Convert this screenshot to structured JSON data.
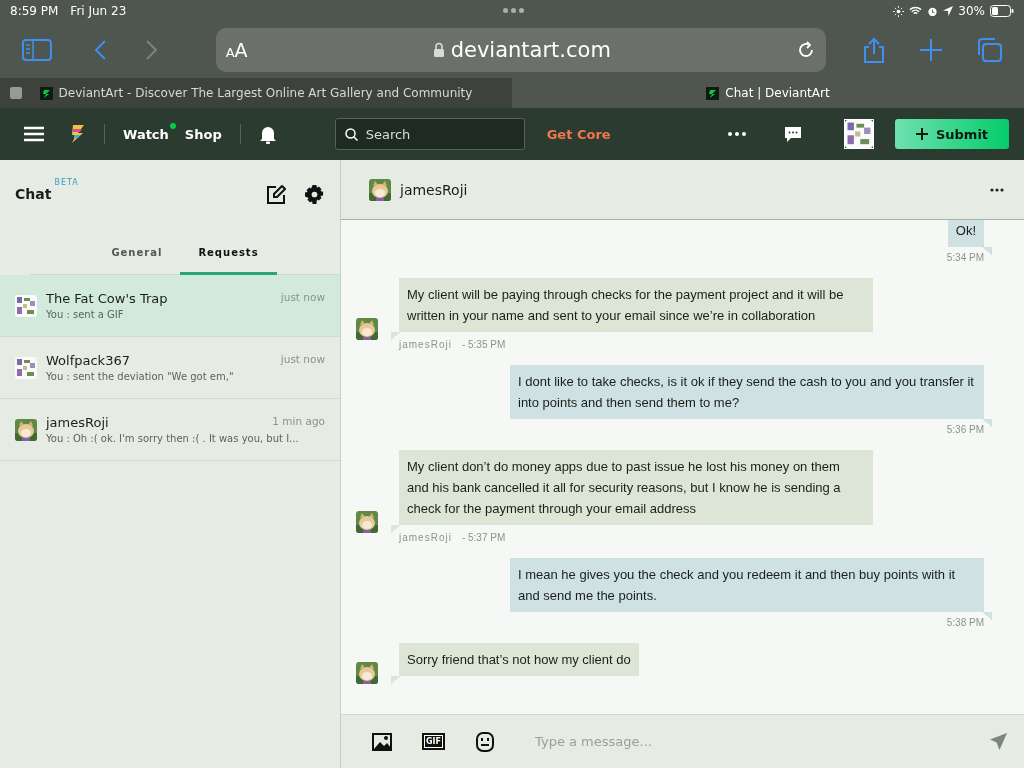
{
  "status_bar": {
    "time": "8:59 PM",
    "date": "Fri Jun 23",
    "battery": "30%"
  },
  "browser": {
    "text_size": "AA",
    "url": "deviantart.com",
    "tabs": [
      {
        "title": "DeviantArt - Discover The Largest Online Art Gallery and Community",
        "selected": false
      },
      {
        "title": "Chat | DeviantArt",
        "selected": true
      }
    ]
  },
  "nav": {
    "links": [
      {
        "label": "Watch",
        "has_update": true
      },
      {
        "label": "Shop",
        "has_update": false
      }
    ],
    "search": {
      "placeholder": "Search"
    },
    "get_core": "Get Core",
    "submit": "Submit"
  },
  "chat_list": {
    "title": "Chat",
    "badge": "BETA",
    "tabs": [
      {
        "label": "General",
        "selected": false
      },
      {
        "label": "Requests",
        "selected": true
      }
    ],
    "conversations": [
      {
        "name": "The Fat Cow's Trap",
        "preview": "You : sent a GIF",
        "time": "just now",
        "selected": true
      },
      {
        "name": "Wolfpack367",
        "preview": "You : sent the deviation \"We got em,\"",
        "time": "just now",
        "selected": false
      },
      {
        "name": "jamesRoji",
        "preview": "You : Oh :( ok. I'm sorry then :( . It was you, but I...",
        "time": "1 min ago",
        "selected": false
      }
    ]
  },
  "conversation": {
    "name": "jamesRoji",
    "messages": [
      {
        "kind": "sent",
        "text": "Ok!",
        "time": "5:34 PM"
      },
      {
        "kind": "received",
        "text": "My client will be paying through checks for the payment project and it will be written in your name and sent to your email since we’re in collaboration",
        "sender": "jamesRoji",
        "time": "- 5:35 PM"
      },
      {
        "kind": "sent",
        "text": "I dont like to take checks, is it ok if they send the cash to you and you transfer it into points and then send them to me?",
        "time": "5:36 PM"
      },
      {
        "kind": "received",
        "text": "My client don’t do money apps due to past issue he lost his money on them and his bank cancelled it all for security reasons, but I know he is sending a check for the payment through your email address",
        "sender": "jamesRoji",
        "time": "- 5:37 PM"
      },
      {
        "kind": "sent",
        "text": "I mean he gives you the check and you redeem it and then buy points with it and send me the points.",
        "time": "5:38 PM"
      },
      {
        "kind": "received",
        "text": "Sorry friend that’s not how my client do"
      }
    ]
  },
  "composer": {
    "gif_label": "GIF",
    "placeholder": "Type a message..."
  }
}
